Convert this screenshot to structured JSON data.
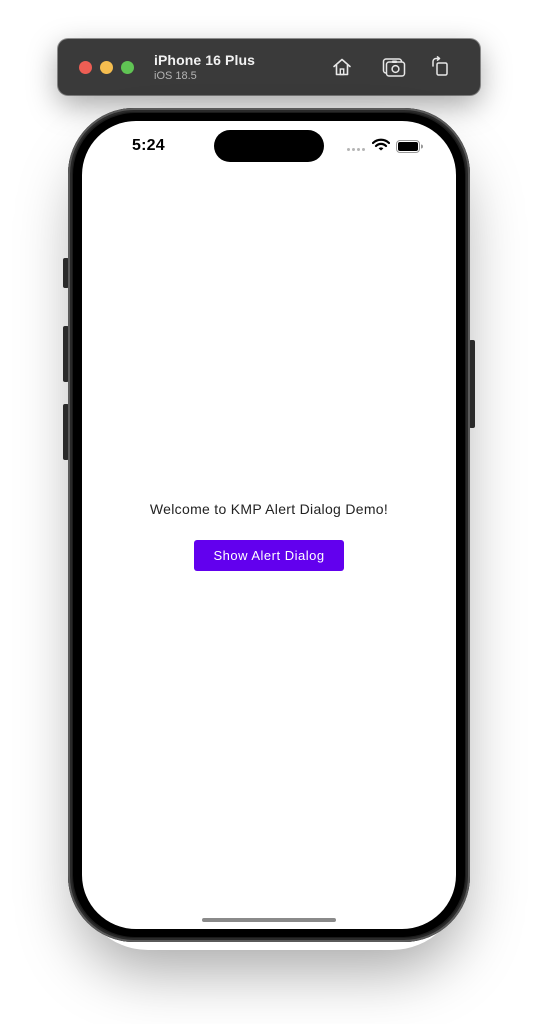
{
  "simulator": {
    "device_name": "iPhone 16 Plus",
    "os_version": "iOS 18.5",
    "toolbar_icons": [
      "home-icon",
      "screenshot-icon",
      "rotate-icon"
    ]
  },
  "status_bar": {
    "time": "5:24",
    "icons": [
      "wifi-icon",
      "battery-icon"
    ]
  },
  "app": {
    "welcome_text": "Welcome to KMP Alert Dialog Demo!",
    "show_dialog_button": "Show Alert Dialog"
  },
  "colors": {
    "accent": "#6200ee",
    "toolbar_bg": "#3a3a3a",
    "traffic_close": "#ee5e54",
    "traffic_minimize": "#f5bd4f",
    "traffic_maximize": "#60c454"
  }
}
